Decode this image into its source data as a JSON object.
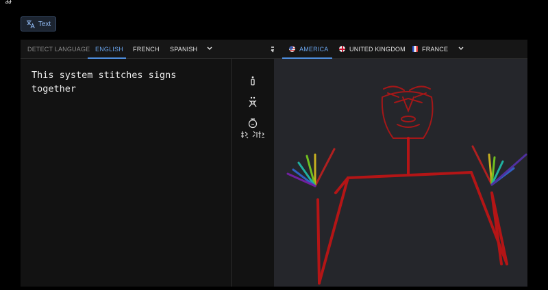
{
  "topbar": {
    "glyph": "ʝʝ"
  },
  "mode_chip": {
    "label": "Text",
    "icon": "translate-icon"
  },
  "source_languages": {
    "tabs": [
      {
        "label": "DETECT LANGUAGE",
        "state": "muted"
      },
      {
        "label": "ENGLISH",
        "state": "active"
      },
      {
        "label": "FRENCH",
        "state": "normal"
      },
      {
        "label": "SPANISH",
        "state": "normal"
      }
    ],
    "more_icon": "chevron-down-icon"
  },
  "swap_icon": "swap-arrows-icon",
  "target_languages": {
    "tabs": [
      {
        "label": "AMERICA",
        "flag": "us-flag-icon",
        "state": "active"
      },
      {
        "label": "UNITED KINGDOM",
        "flag": "uk-flag-icon",
        "state": "normal"
      },
      {
        "label": "FRANCE",
        "flag": "france-flag-icon",
        "state": "normal"
      }
    ],
    "more_icon": "chevron-down-icon"
  },
  "input": {
    "text": "This system stitches signs together"
  },
  "tools": [
    {
      "icon": "single-figure-icon"
    },
    {
      "icon": "figure-group-icon"
    },
    {
      "icon": "avatar-head-icon"
    },
    {
      "icon": "signwriting-glyphs-icon"
    }
  ],
  "colors": {
    "accent": "#4f8fe0",
    "active_tab_text": "#6aa5ee",
    "skeleton_red": "#c41414",
    "render_background": "#25262b"
  }
}
